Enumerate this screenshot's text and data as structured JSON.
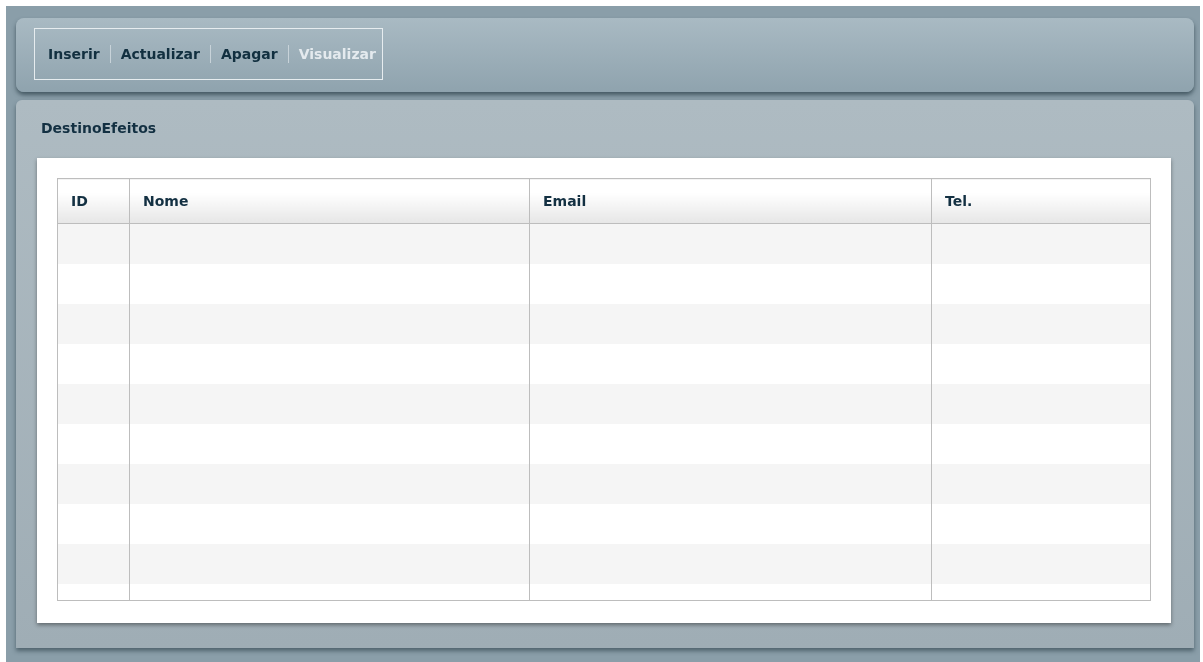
{
  "toolbar": {
    "items": [
      {
        "label": "Inserir",
        "disabled": false
      },
      {
        "label": "Actualizar",
        "disabled": false
      },
      {
        "label": "Apagar",
        "disabled": false
      },
      {
        "label": "Visualizar",
        "disabled": true
      }
    ]
  },
  "panel": {
    "title": "DestinoEfeitos"
  },
  "table": {
    "columns": [
      "ID",
      "Nome",
      "Email",
      "Tel."
    ]
  }
}
